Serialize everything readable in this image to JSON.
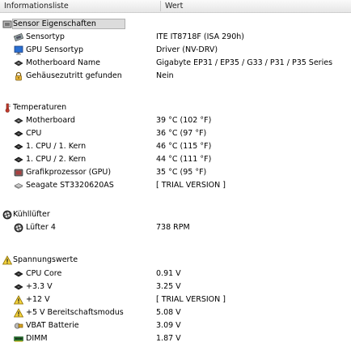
{
  "header": {
    "col1": "Informationsliste",
    "col2": "Wert"
  },
  "groups": [
    {
      "title": "Sensor Eigenschaften",
      "icon": "chip-icon",
      "selected": true,
      "items": [
        {
          "label": "Sensortyp",
          "value": "ITE IT8718F  (ISA 290h)",
          "icon": "sensor-icon"
        },
        {
          "label": "GPU Sensortyp",
          "value": "Driver  (NV-DRV)",
          "icon": "monitor-icon"
        },
        {
          "label": "Motherboard Name",
          "value": "Gigabyte EP31 / EP35 / G33 / P31 / P35 Series",
          "icon": "motherboard-icon"
        },
        {
          "label": "Gehäusezutritt gefunden",
          "value": "Nein",
          "icon": "lock-icon"
        }
      ]
    },
    {
      "title": "Temperaturen",
      "icon": "thermometer-icon",
      "items": [
        {
          "label": "Motherboard",
          "value": "39 °C  (102 °F)",
          "icon": "motherboard-icon"
        },
        {
          "label": "CPU",
          "value": "36 °C  (97 °F)",
          "icon": "cpu-icon"
        },
        {
          "label": "1. CPU / 1. Kern",
          "value": "46 °C  (115 °F)",
          "icon": "cpu-icon"
        },
        {
          "label": "1. CPU / 2. Kern",
          "value": "44 °C  (111 °F)",
          "icon": "cpu-icon"
        },
        {
          "label": "Grafikprozessor (GPU)",
          "value": "35 °C  (95 °F)",
          "icon": "gpu-icon"
        },
        {
          "label": "Seagate ST3320620AS",
          "value": "[ TRIAL VERSION ]",
          "icon": "harddisk-icon"
        }
      ]
    },
    {
      "title": "Kühllüfter",
      "icon": "fan-icon",
      "items": [
        {
          "label": "Lüfter 4",
          "value": "738 RPM",
          "icon": "fan-icon"
        }
      ]
    },
    {
      "title": "Spannungswerte",
      "icon": "warning-icon",
      "items": [
        {
          "label": "CPU Core",
          "value": "0.91 V",
          "icon": "cpu-icon"
        },
        {
          "label": "+3.3 V",
          "value": "3.25 V",
          "icon": "cpu-icon"
        },
        {
          "label": "+12 V",
          "value": "[ TRIAL VERSION ]",
          "icon": "warning-icon"
        },
        {
          "label": "+5 V Bereitschaftsmodus",
          "value": "5.08 V",
          "icon": "warning-icon"
        },
        {
          "label": "VBAT Batterie",
          "value": "3.09 V",
          "icon": "battery-icon"
        },
        {
          "label": "DIMM",
          "value": "1.87 V",
          "icon": "memory-icon"
        }
      ]
    }
  ]
}
